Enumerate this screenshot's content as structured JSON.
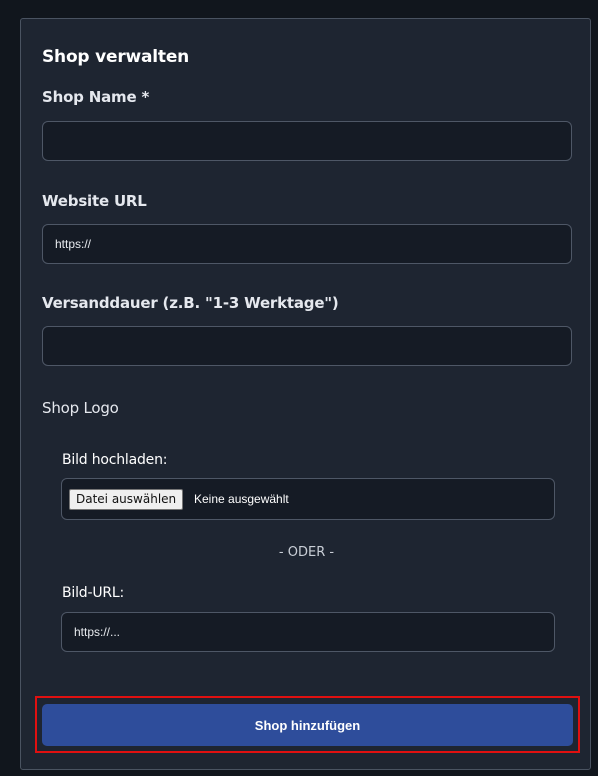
{
  "form": {
    "title": "Shop verwalten",
    "shop_name": {
      "label": "Shop Name *",
      "value": "",
      "placeholder": ""
    },
    "website_url": {
      "label": "Website URL",
      "value": "",
      "placeholder": "https://"
    },
    "shipping_time": {
      "label": "Versanddauer (z.B. \"1-3 Werktage\")",
      "value": "",
      "placeholder": ""
    },
    "logo": {
      "label": "Shop Logo",
      "upload_label": "Bild hochladen:",
      "file_button": "Datei auswählen",
      "file_status": "Keine ausgewählt",
      "separator": "- ODER -",
      "url_label": "Bild-URL:",
      "url_placeholder": "https://..."
    },
    "submit_label": "Shop hinzufügen"
  },
  "colors": {
    "panel_bg": "#1e2531",
    "field_bg": "#151b25",
    "submit_bg": "#2e4d9b",
    "highlight_border": "#e01010"
  }
}
